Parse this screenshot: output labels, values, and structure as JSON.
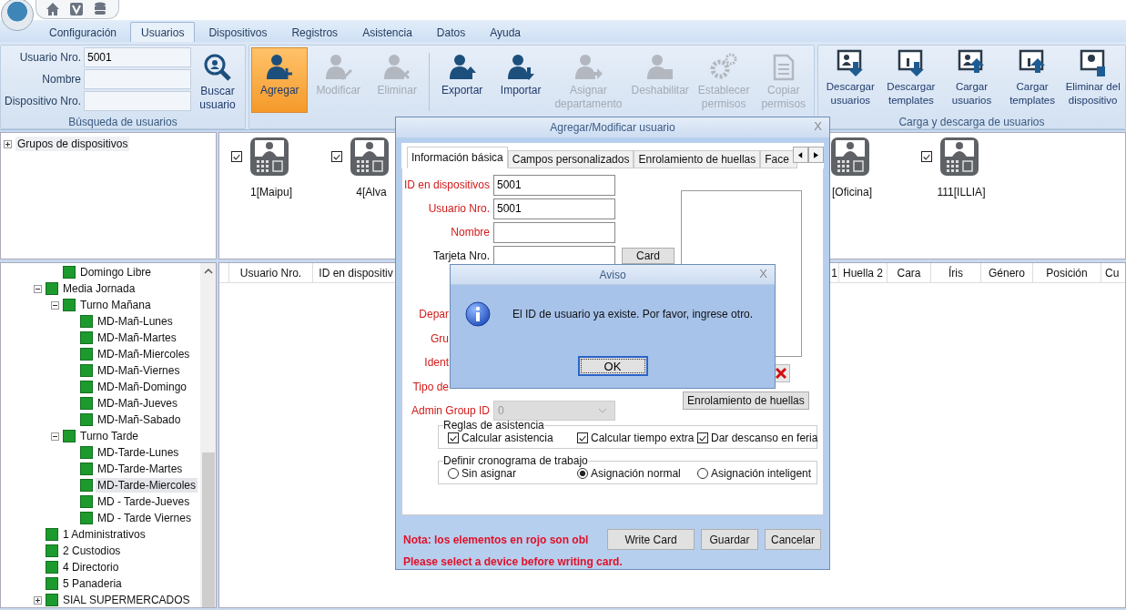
{
  "menu_tabs": [
    {
      "label": "Configuración",
      "selected": false
    },
    {
      "label": "Usuarios",
      "selected": true
    },
    {
      "label": "Dispositivos",
      "selected": false
    },
    {
      "label": "Registros",
      "selected": false
    },
    {
      "label": "Asistencia",
      "selected": false
    },
    {
      "label": "Datos",
      "selected": false
    },
    {
      "label": "Ayuda",
      "selected": false
    }
  ],
  "ribbon": {
    "search": {
      "title": "Búsqueda de usuarios",
      "button": "Buscar usuario",
      "fields": [
        {
          "label": "Usuario Nro.",
          "value": "5001"
        },
        {
          "label": "Nombre"
        },
        {
          "label": "Dispositivo Nro."
        }
      ]
    },
    "user_tools": {
      "buttons": [
        {
          "label": "Agregar",
          "kind": "add",
          "selected": true,
          "disabled": false
        },
        {
          "label": "Modificar",
          "kind": "edit",
          "selected": false,
          "disabled": true
        },
        {
          "label": "Eliminar",
          "kind": "delete",
          "selected": false,
          "disabled": true
        },
        {
          "label": "Exportar",
          "kind": "export",
          "selected": false,
          "disabled": false
        },
        {
          "label": "Importar",
          "kind": "import",
          "selected": false,
          "disabled": false
        },
        {
          "label": "Asignar departamento",
          "kind": "assign",
          "selected": false,
          "disabled": true
        },
        {
          "label": "Deshabilitar",
          "kind": "disable",
          "selected": false,
          "disabled": true
        },
        {
          "label": "Establecer permisos",
          "kind": "perms",
          "selected": false,
          "disabled": true
        },
        {
          "label": "Copiar permisos",
          "kind": "copy",
          "selected": false,
          "disabled": true
        }
      ]
    },
    "transfer": {
      "title": "Carga y descarga de usuarios",
      "buttons": [
        {
          "label": "Descargar usuarios",
          "kind": "download-users"
        },
        {
          "label": "Descargar templates",
          "kind": "download-templates"
        },
        {
          "label": "Cargar usuarios",
          "kind": "upload-users"
        },
        {
          "label": "Cargar templates",
          "kind": "upload-templates"
        },
        {
          "label": "Eliminar del dispositivo",
          "kind": "remove"
        }
      ]
    }
  },
  "device_groups": [
    {
      "label": "Grupos de dispositivos",
      "expanded": false
    }
  ],
  "devices": [
    {
      "label": "1[Maipu]",
      "checked": true
    },
    {
      "label": "4[Alva",
      "checked": true
    },
    {
      "label": "[Oficina]"
    },
    {
      "label": "111[ILLIA]",
      "checked": true
    }
  ],
  "department_tree": [
    {
      "children": [
        {
          "children": [
            {
              "label": "Domingo Libre",
              "selected": false
            }
          ]
        },
        {
          "label": "Media Jornada",
          "expanded": true,
          "selected": false,
          "children": [
            {
              "label": "Turno Mañana",
              "expanded": true,
              "selected": false,
              "children": [
                {
                  "label": "MD-Mañ-Lunes",
                  "selected": false
                },
                {
                  "label": "MD-Mañ-Martes",
                  "selected": false
                },
                {
                  "label": "MD-Mañ-Miercoles",
                  "selected": false
                },
                {
                  "label": "MD-Mañ-Viernes",
                  "selected": false
                },
                {
                  "label": "MD-Mañ-Domingo",
                  "selected": false
                },
                {
                  "label": "MD-Mañ-Jueves",
                  "selected": false
                },
                {
                  "label": "MD-Mañ-Sabado",
                  "selected": false
                }
              ]
            },
            {
              "label": "Turno Tarde",
              "expanded": true,
              "selected": false,
              "children": [
                {
                  "label": "MD-Tarde-Lunes",
                  "selected": false
                },
                {
                  "label": "MD-Tarde-Martes",
                  "selected": false
                },
                {
                  "label": "MD-Tarde-Miercoles",
                  "selected": true
                },
                {
                  "label": "MD - Tarde-Jueves",
                  "selected": false
                },
                {
                  "label": "MD - Tarde Viernes",
                  "selected": false
                }
              ]
            }
          ]
        },
        {
          "label": "1 Administrativos",
          "selected": false
        },
        {
          "label": "2 Custodios",
          "selected": false
        },
        {
          "label": "4 Directorio",
          "selected": false
        },
        {
          "label": "5 Panaderia",
          "selected": false
        },
        {
          "label": "SIAL SUPERMERCADOS",
          "expanded": false,
          "selected": false
        }
      ]
    }
  ],
  "user_table": {
    "columns": [
      "Usuario Nro.",
      "ID en dispositiv",
      "1",
      "Huella 2",
      "Cara",
      "Íris",
      "Género",
      "Posición",
      "Cu"
    ]
  },
  "user_dialog": {
    "title": "Agregar/Modificar usuario",
    "close": "X",
    "tabs": [
      {
        "label": "Información básica",
        "selected": true
      },
      {
        "label": "Campos personalizados",
        "selected": false
      },
      {
        "label": "Enrolamiento de huellas",
        "selected": false
      },
      {
        "label": "Face",
        "selected": false
      }
    ],
    "fields": [
      {
        "label": "ID en dispositivos",
        "kind": "text",
        "required": true,
        "value": "5001"
      },
      {
        "label": "Usuario Nro.",
        "kind": "text",
        "required": true,
        "value": "5001"
      },
      {
        "label": "Nombre",
        "kind": "text",
        "required": true
      },
      {
        "label": "Tarjeta Nro.",
        "kind": "card",
        "required": false,
        "button": "Card"
      },
      {
        "label": "Depar",
        "kind": "covered",
        "required": true
      },
      {
        "label": "Gru",
        "kind": "covered",
        "required": true
      },
      {
        "label": "Ident",
        "kind": "covered",
        "required": true
      },
      {
        "label": "Tipo de",
        "kind": "covered",
        "required": true
      },
      {
        "label": "Admin Group ID",
        "kind": "select",
        "required": true,
        "value": "0",
        "disabled": true
      }
    ],
    "fingerprint_button": "Enrolamiento de huellas",
    "attendance_rules": {
      "title": "Reglas de asistencia",
      "options": [
        {
          "label": "Calcular asistencia",
          "checked": true
        },
        {
          "label": "Calcular tiempo extra",
          "checked": true
        },
        {
          "label": "Dar descanso en feria",
          "checked": true
        }
      ]
    },
    "schedule": {
      "title": "Definir cronograma de trabajo",
      "options": [
        {
          "label": "Sin asignar",
          "selected": false
        },
        {
          "label": "Asignación normal",
          "selected": true
        },
        {
          "label": "Asignación inteligent",
          "selected": false
        }
      ]
    },
    "note": "Nota: los elementos en rojo son obl",
    "warning": "Please select a device before writing card.",
    "buttons": [
      "Write Card",
      "Guardar",
      "Cancelar"
    ]
  },
  "alert": {
    "title": "Aviso",
    "close": "X",
    "message": "El ID de usuario ya existe. Por favor, ingrese otro.",
    "button": "OK"
  }
}
